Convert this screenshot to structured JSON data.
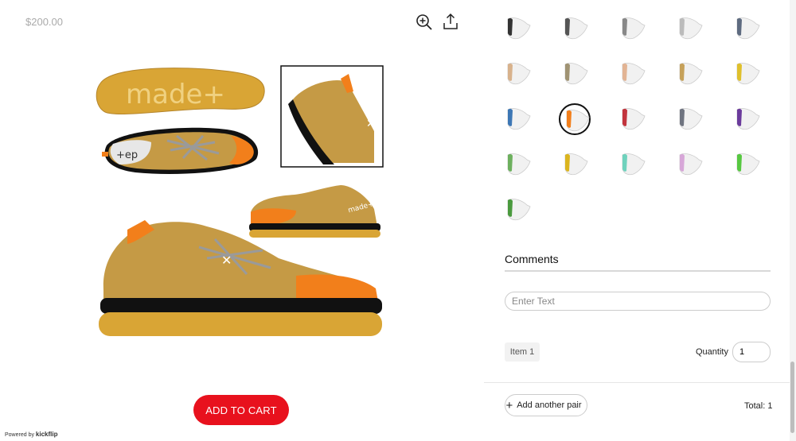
{
  "product": {
    "price": "$200.00"
  },
  "toolbar": {
    "zoom_icon": "zoom-in-icon",
    "share_icon": "share-icon"
  },
  "viewer": {
    "sole_logo": "made+",
    "side_logo": "made+",
    "sole_view_logo": "+ep"
  },
  "actions": {
    "add_to_cart": "ADD TO CART"
  },
  "branding": {
    "powered_by": "Powered by",
    "brand": "kickflip"
  },
  "colors": {
    "accent": "#e8111d",
    "shoe_upper": "#c59a45",
    "sole": "#d9a535",
    "toe_cap": "#f27f1b"
  },
  "swatch_colors": [
    "#333333",
    "#555555",
    "#888888",
    "#bbbbbb",
    "#5e6b80",
    "#d8b28c",
    "#a09373",
    "#e2b494",
    "#c6a15a",
    "#dfc02c",
    "#3d77b5",
    "#f27f1b",
    "#c2343d",
    "#6f7480",
    "#6b3b9c",
    "#6db05e",
    "#dbb51f",
    "#6fd2bd",
    "#d7a7d8",
    "#57c841",
    "#4a9a3e"
  ],
  "selected_swatch_index": 11,
  "comments": {
    "title": "Comments",
    "placeholder": "Enter Text"
  },
  "item": {
    "label": "Item 1",
    "quantity_label": "Quantity",
    "quantity_value": "1"
  },
  "footer": {
    "add_pair_label": "Add another pair",
    "total_label": "Total: 1"
  }
}
